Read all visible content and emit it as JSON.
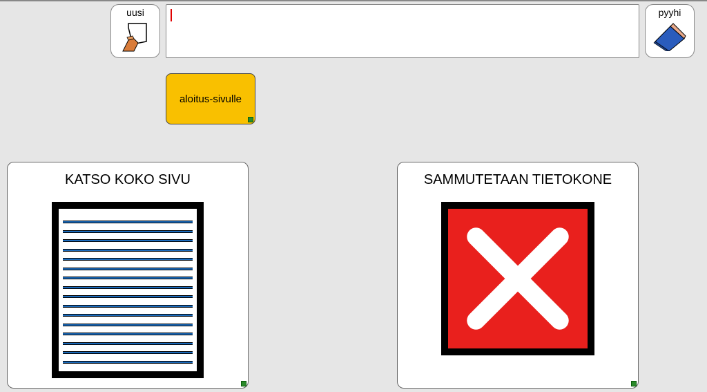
{
  "toolbar": {
    "new_label": "uusi",
    "erase_label": "pyyhi"
  },
  "input": {
    "value": ""
  },
  "home_button": {
    "label": "aloitus-sivulle"
  },
  "card_viewpage": {
    "title": "KATSO KOKO SIVU"
  },
  "card_shutdown": {
    "title": "SAMMUTETAAN TIETOKONE"
  }
}
